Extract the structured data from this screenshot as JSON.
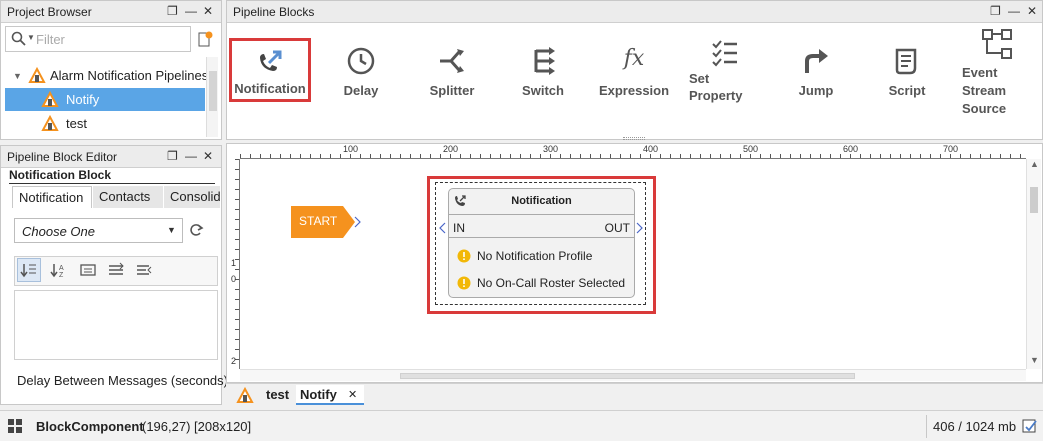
{
  "project_browser": {
    "title": "Project Browser",
    "filter_placeholder": "Filter",
    "tree": {
      "root": "Alarm Notification Pipelines",
      "items": [
        "Notify",
        "test"
      ]
    }
  },
  "block_editor": {
    "title": "Pipeline Block Editor",
    "section": "Notification Block",
    "tabs": [
      "Notification",
      "Contacts",
      "Consolid"
    ],
    "select_value": "Choose One",
    "footer_label": "Delay Between Messages (seconds)"
  },
  "pipeline_blocks": {
    "title": "Pipeline Blocks",
    "items": [
      {
        "label": "Notification",
        "icon": "phone-arrow-icon"
      },
      {
        "label": "Delay",
        "icon": "clock-icon"
      },
      {
        "label": "Splitter",
        "icon": "splitter-icon"
      },
      {
        "label": "Switch",
        "icon": "switch-icon"
      },
      {
        "label": "Expression",
        "icon": "fx-icon"
      },
      {
        "label": "Set Property",
        "icon": "checklist-icon"
      },
      {
        "label": "Jump",
        "icon": "jump-arrow-icon"
      },
      {
        "label": "Script",
        "icon": "script-icon"
      },
      {
        "label": "Event Stream Source",
        "icon": "event-stream-icon"
      }
    ]
  },
  "canvas": {
    "ruler_labels": [
      "100",
      "200",
      "300",
      "400",
      "500",
      "600",
      "700"
    ],
    "vruler_labels": [
      "1",
      "0",
      "2"
    ],
    "start_label": "START",
    "block": {
      "title": "Notification",
      "in_label": "IN",
      "out_label": "OUT",
      "warnings": [
        "No Notification Profile",
        "No On-Call Roster Selected"
      ]
    },
    "tabs": [
      "test",
      "Notify"
    ]
  },
  "status_bar": {
    "component": "BlockComponent",
    "detail": "(196,27) [208x120]",
    "memory": "406 / 1024 mb"
  },
  "colors": {
    "selection": "#5aa5e6",
    "highlight_red": "#d93a3a",
    "start_orange": "#f5921e",
    "warning_yellow": "#f2b807"
  }
}
